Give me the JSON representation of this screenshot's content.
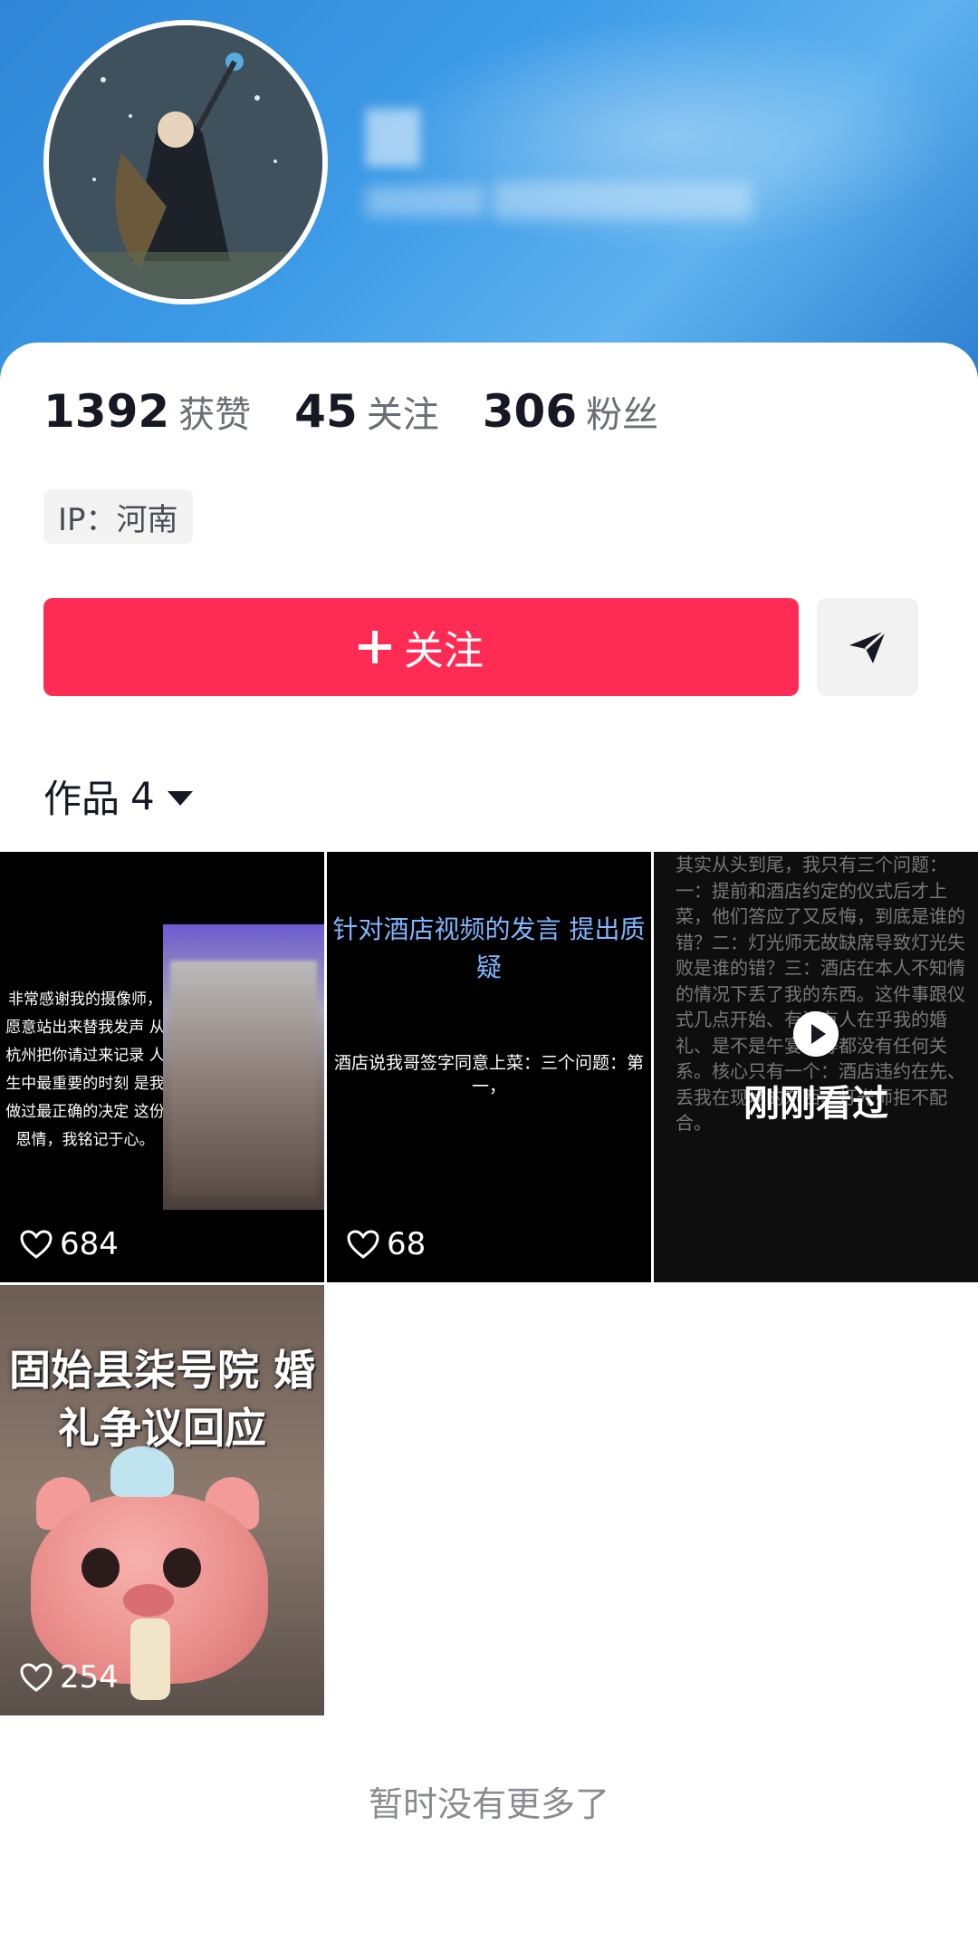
{
  "profile": {
    "stats": [
      {
        "value": "1392",
        "label": "获赞"
      },
      {
        "value": "45",
        "label": "关注"
      },
      {
        "value": "306",
        "label": "粉丝"
      }
    ],
    "ip": "IP：河南",
    "follow_label": "关注",
    "works_label": "作品",
    "works_count": "4"
  },
  "videos": [
    {
      "likes": "684",
      "overlay_text": "非常感谢我的摄像师，愿意站出来替我发声 从杭州把你请过来记录 人生中最重要的时刻 是我做过最正确的决定 这份恩情，我铭记于心。"
    },
    {
      "likes": "68",
      "title": "针对酒店视频的发言 提出质疑",
      "body": "酒店说我哥签字同意上菜：三个问题：第一，"
    },
    {
      "likes": "",
      "status": "刚刚看过",
      "body": "其实从头到尾，我只有三个问题：一：提前和酒店约定的仪式后才上菜，他们答应了又反悔，到底是谁的错？二：灯光师无故缺席导致灯光失败是谁的错？三：酒店在本人不知情的情况下丢了我的东西。这件事跟仪式几点开始、有没有人在乎我的婚礼、是不是午宴等等都没有任何关系。核心只有一个：酒店违约在先、丢我在现场的东西、灯光师拒不配合。"
    },
    {
      "likes": "254",
      "title": "固始县柒号院 婚礼争议回应"
    }
  ],
  "footer": "暂时没有更多了",
  "colors": {
    "follow_button": "#fe2c55",
    "header_blue": "#3c9ae6"
  }
}
